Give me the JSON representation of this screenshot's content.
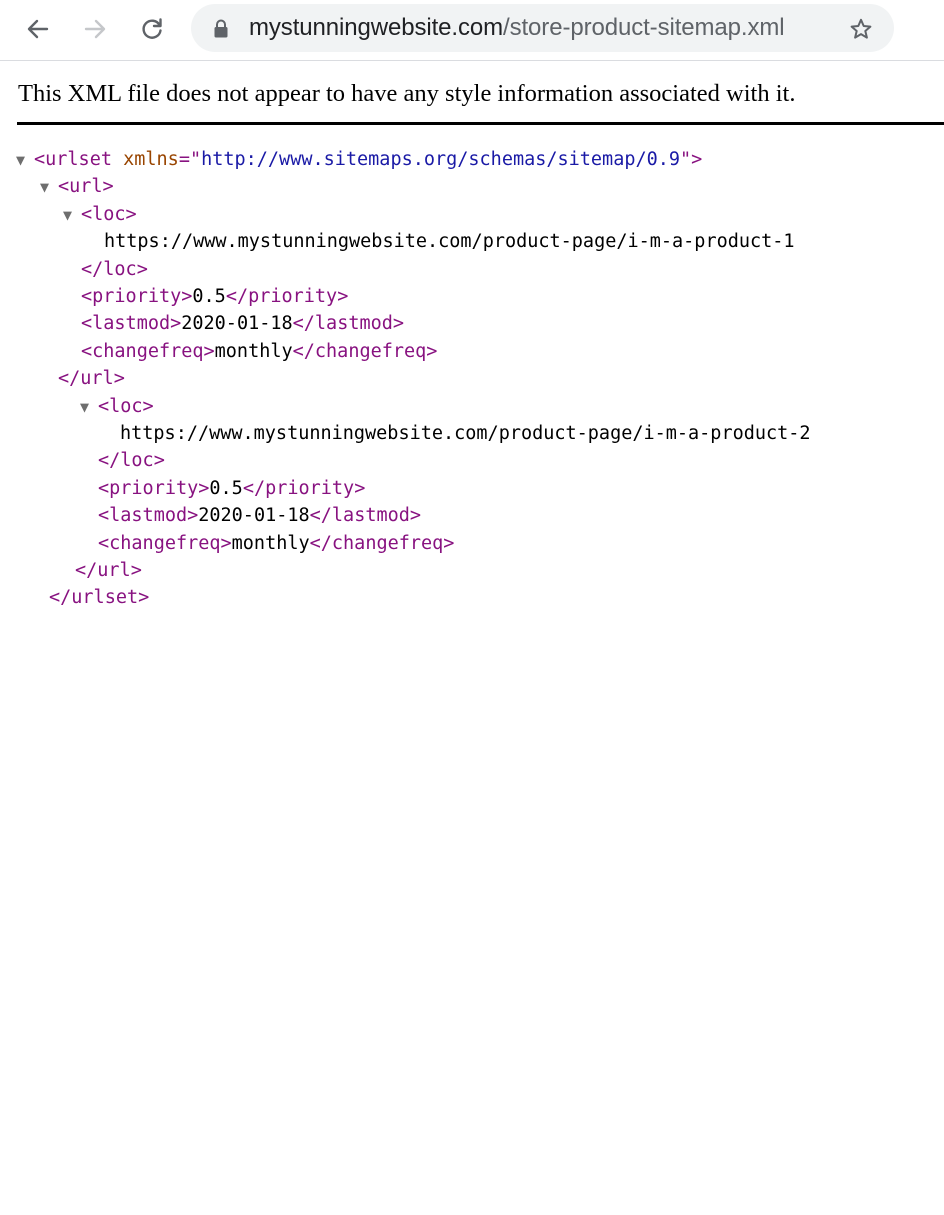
{
  "browser": {
    "url_host": "mystunningwebsite.com",
    "url_path": "/store-product-sitemap.xml",
    "icons": {
      "back": "arrow-left",
      "forward": "arrow-right",
      "reload": "reload",
      "lock": "lock",
      "bookmark": "star-outline"
    }
  },
  "notice": {
    "text": "This XML file does not appear to have any style information associated",
    "text_tail": "with it."
  },
  "xml": {
    "urlset_open": "<urlset",
    "urlset_attr_name": "xmlns",
    "urlset_attr_eq": "=\"",
    "urlset_attr_value": "http://www.sitemaps.org/schemas/sitemap/0.9",
    "urlset_attr_close": "\">",
    "urlset_close": "</urlset>",
    "entries": [
      {
        "url_open": "<url>",
        "loc_open": "<loc>",
        "loc_value": "https://www.mystunningwebsite.com/product-page/i-m-a-product-1",
        "loc_close": "</loc>",
        "priority_open": "<priority>",
        "priority_value": "0.5",
        "priority_close": "</priority>",
        "lastmod_open": "<lastmod>",
        "lastmod_value": "2020-01-18",
        "lastmod_close": "</lastmod>",
        "changefreq_open": "<changefreq>",
        "changefreq_value": "monthly",
        "changefreq_close": "</changefreq>",
        "url_close": "</url>"
      },
      {
        "loc_open": "<loc>",
        "loc_value": "https://www.mystunningwebsite.com/product-page/i-m-a-product-2",
        "loc_close": "</loc>",
        "priority_open": "<priority>",
        "priority_value": "0.5",
        "priority_close": "</priority>",
        "lastmod_open": "<lastmod>",
        "lastmod_value": "2020-01-18",
        "lastmod_close": "</lastmod>",
        "changefreq_open": "<changefreq>",
        "changefreq_value": "monthly",
        "changefreq_close": "</changefreq>",
        "url_close": "</url>"
      }
    ],
    "toggle_glyph": "▼"
  },
  "colors": {
    "tag": "#881280",
    "attr_name": "#994500",
    "attr_value": "#1a1aa6",
    "text": "#000000",
    "omnibox_bg": "#f1f3f4"
  }
}
